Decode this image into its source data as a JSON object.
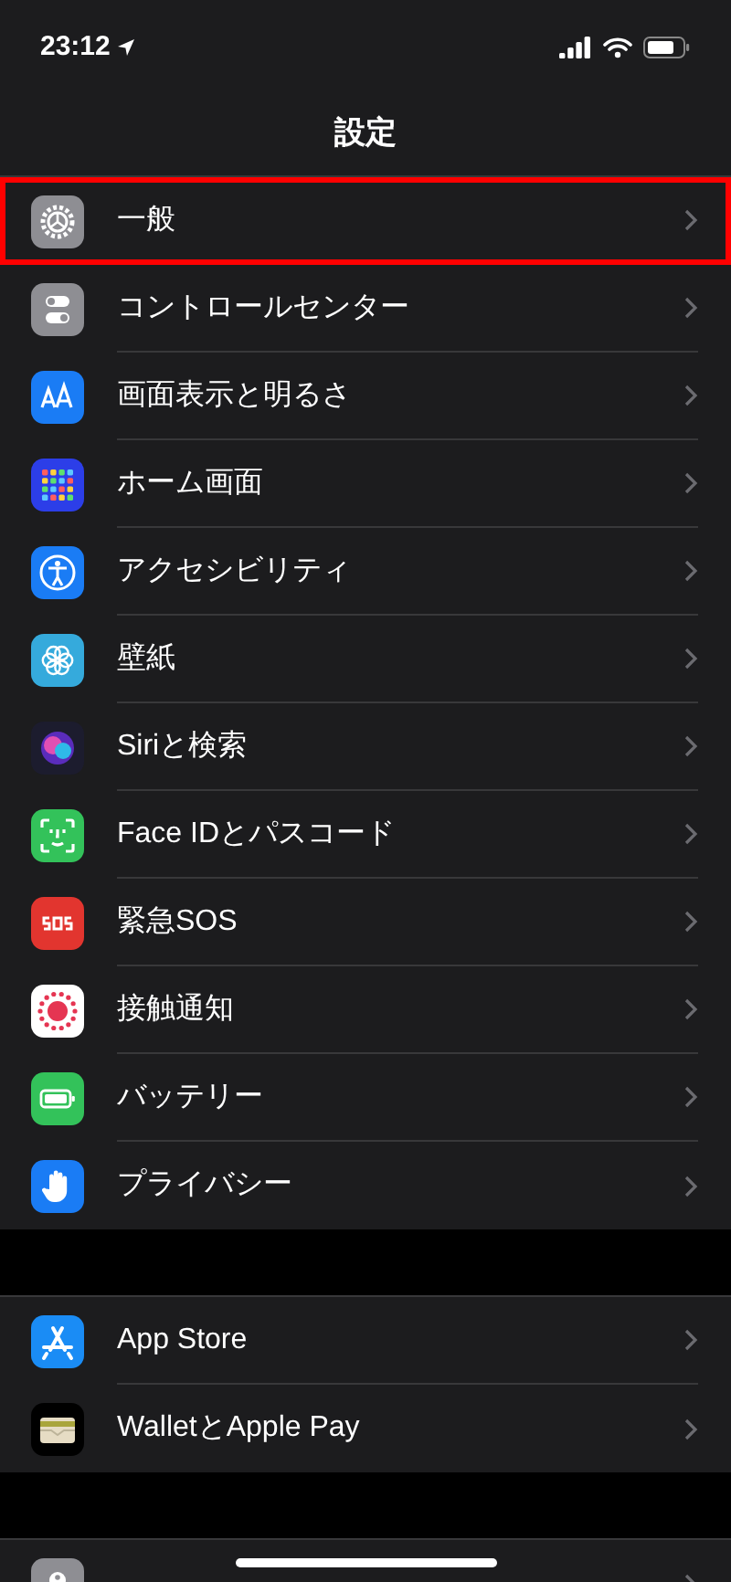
{
  "status_bar": {
    "time": "23:12"
  },
  "title": "設定",
  "groups": [
    {
      "items": [
        {
          "label": "一般",
          "highlighted": true
        },
        {
          "label": "コントロールセンター",
          "highlighted": false
        },
        {
          "label": "画面表示と明るさ",
          "highlighted": false
        },
        {
          "label": "ホーム画面",
          "highlighted": false
        },
        {
          "label": "アクセシビリティ",
          "highlighted": false
        },
        {
          "label": "壁紙",
          "highlighted": false
        },
        {
          "label": "Siriと検索",
          "highlighted": false
        },
        {
          "label": "Face IDとパスコード",
          "highlighted": false
        },
        {
          "label": "緊急SOS",
          "highlighted": false
        },
        {
          "label": "接触通知",
          "highlighted": false
        },
        {
          "label": "バッテリー",
          "highlighted": false
        },
        {
          "label": "プライバシー",
          "highlighted": false
        }
      ]
    },
    {
      "items": [
        {
          "label": "App Store",
          "highlighted": false
        },
        {
          "label": "WalletとApple Pay",
          "highlighted": false
        }
      ]
    },
    {
      "items": [
        {
          "highlighted": false
        }
      ]
    }
  ]
}
